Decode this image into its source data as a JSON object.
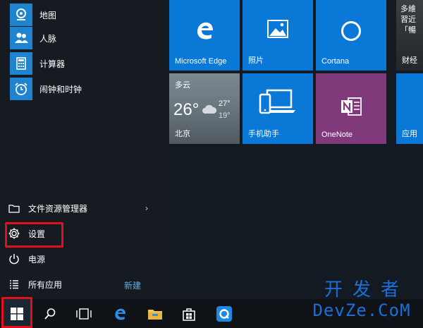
{
  "apps": [
    {
      "label": "地图",
      "icon": "map-pin-icon"
    },
    {
      "label": "人脉",
      "icon": "people-icon"
    },
    {
      "label": "计算器",
      "icon": "calculator-icon"
    },
    {
      "label": "闹钟和时钟",
      "icon": "alarm-clock-icon"
    }
  ],
  "system": {
    "explorer": "文件资源管理器",
    "settings": "设置",
    "power": "电源",
    "all_apps": "所有应用",
    "new_badge": "新建"
  },
  "tiles": {
    "edge": "Microsoft Edge",
    "photos": "照片",
    "cortana": "Cortana",
    "phone": "手机助手",
    "onenote": "OneNote",
    "news_text": [
      "多維",
      "習近",
      "「暢"
    ],
    "finance": "财经",
    "store_partial": "应用"
  },
  "weather": {
    "condition": "多云",
    "temp": "26°",
    "high": "27°",
    "low": "19°",
    "city": "北京"
  },
  "watermark": {
    "top": "开发者",
    "bottom": "DevZe.CoM"
  },
  "colors": {
    "tile_blue": "#0a78d7",
    "onenote_purple": "#80397b",
    "highlight_red": "#e0101c"
  }
}
